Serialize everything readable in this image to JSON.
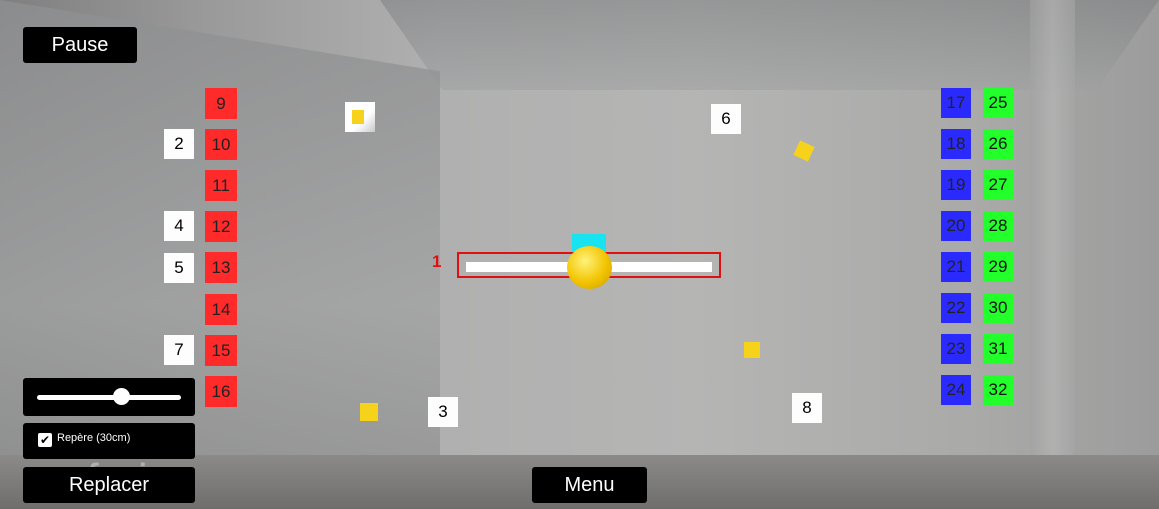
{
  "buttons": {
    "pause": "Pause",
    "replace": "Replacer",
    "menu": "Menu"
  },
  "settings": {
    "checkbox_label": "Repère (30cm)",
    "checkbox_checked": true,
    "slider_value": 0.6
  },
  "watermark": "vuforia",
  "paddle_label": "1",
  "red_blocks": [
    "9",
    "10",
    "11",
    "12",
    "13",
    "14",
    "15",
    "16"
  ],
  "white_markers": [
    "1",
    "2",
    "3",
    "4",
    "5",
    "6",
    "7",
    "8"
  ],
  "blue_blocks": [
    "17",
    "18",
    "19",
    "20",
    "21",
    "22",
    "23",
    "24"
  ],
  "green_blocks": [
    "25",
    "26",
    "27",
    "28",
    "29",
    "30",
    "31",
    "32"
  ],
  "colors": {
    "red": "#ff2a2a",
    "blue": "#2a2aff",
    "green": "#22ff2a",
    "ball": "#f2c400",
    "frame": "#e01010"
  }
}
